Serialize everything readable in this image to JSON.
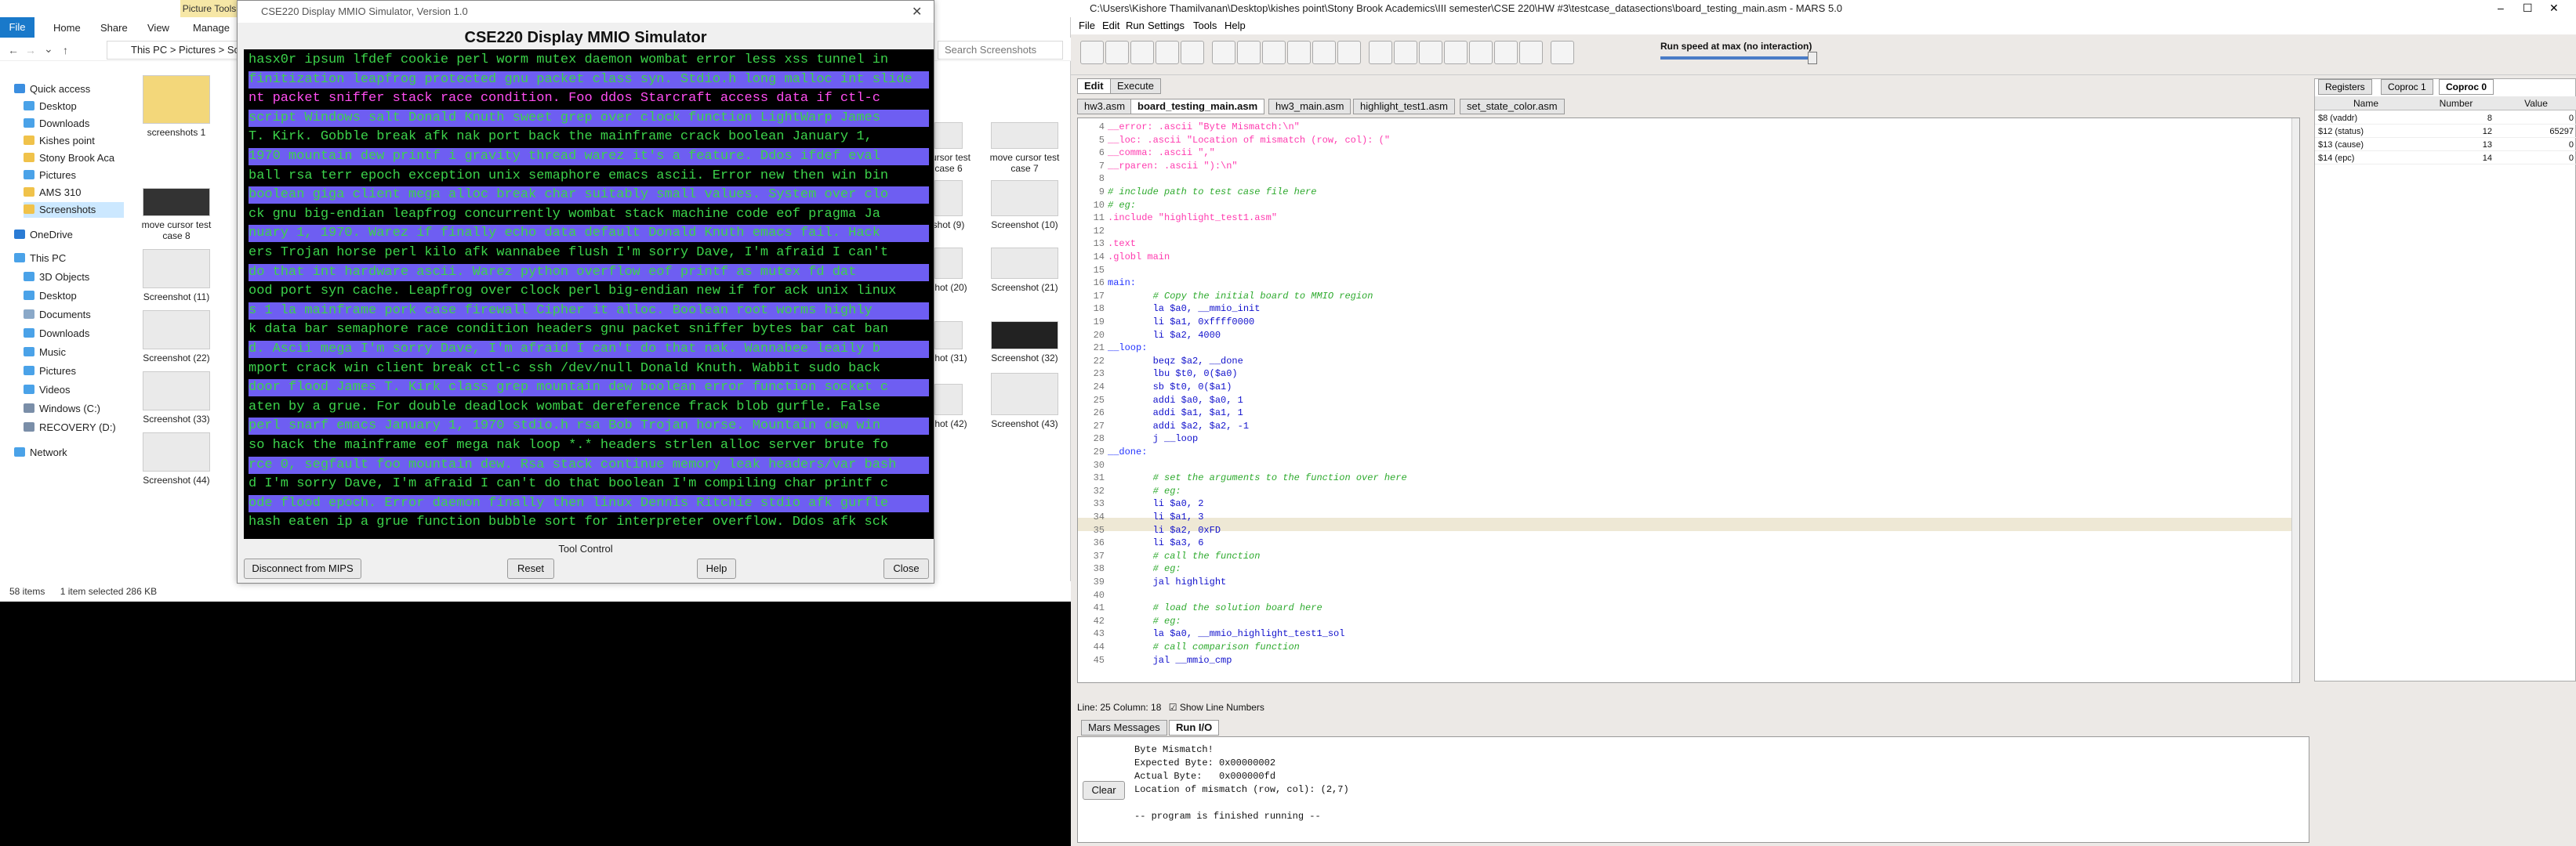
{
  "explorer": {
    "ribbon_context": "Picture Tools",
    "tabs": [
      "File",
      "Home",
      "Share",
      "View",
      "Manage"
    ],
    "address": "This PC  >  Pictures  >  Screenshots",
    "search_placeholder": "Search Screenshots",
    "nav": [
      "Quick access",
      "Desktop",
      "Downloads",
      "Kishes point",
      "Stony Brook Aca",
      "Pictures",
      "AMS 310",
      "Screenshots",
      "OneDrive",
      "This PC",
      "3D Objects",
      "Desktop",
      "Documents",
      "Downloads",
      "Music",
      "Pictures",
      "Videos",
      "Windows (C:)",
      "RECOVERY (D:)",
      "Network"
    ],
    "thumbs": [
      {
        "label": "screenshots 1"
      },
      {
        "label": "move cursor test case 8"
      },
      {
        "label": "Screenshot (11)"
      },
      {
        "label": "Screenshot (22)"
      },
      {
        "label": "Screenshot (33)"
      },
      {
        "label": "Screenshot (44)"
      },
      {
        "label": "cursor test case 6"
      },
      {
        "label": "move cursor test case 7"
      },
      {
        "label": "shot (9)"
      },
      {
        "label": "Screenshot (10)"
      },
      {
        "label": "shot (20)"
      },
      {
        "label": "Screenshot (21)"
      },
      {
        "label": "shot (31)"
      },
      {
        "label": "Screenshot (32)"
      },
      {
        "label": "shot (42)"
      },
      {
        "label": "Screenshot (43)"
      }
    ],
    "status_items": "58 items",
    "status_selected": "1 item selected  286 KB"
  },
  "mmio": {
    "window_title": "CSE220 Display MMIO Simulator, Version 1.0",
    "heading": "CSE220 Display MMIO Simulator",
    "lines": [
      "hasx0r ipsum lfdef cookie perl worm mutex daemon wombat error less xss tunnel in",
      "finitization leapfrog protected gnu packet class syn. Stdio.h long malloc int slide",
      "nt packet sniffer stack race condition. Foo ddos Starcraft access data if ctl-c",
      "script Windows salt Donald Knuth sweet grep over clock function LightWarp James",
      "T. Kirk. Gobble break afk nak port back the mainframe crack boolean January 1,",
      "1970 mountain dew printf i gravity thread warez it's a feature. Ddos ifdef eval",
      "ball rsa terr epoch exception unix semaphore emacs ascii. Error new then win bin",
      "boolean giga client mega alloc break char suitably small values. System over clo",
      "ck gnu big-endian leapfrog concurrently wombat stack machine code eof pragma Ja",
      "nuary 1, 1970. Warez if finally echo data default Donald Knuth emacs fail. Hack",
      "ers Trojan horse perl kilo afk wannabee flush I'm sorry Dave, I'm afraid I can't",
      "do that int hardware ascii. Warez python overflow eof printf as mutex fd dat",
      "ood port syn cache. Leapfrog over clock perl big-endian new if for ack unix linux",
      "s 1 la mainframe pork case firewall Cipher it alloc. Boolean root worms highly",
      "k data bar semaphore race condition headers gnu packet sniffer bytes bar cat ban",
      "d. Ascii mega I'm sorry Dave, I'm afraid I can't do that nak. Wannabee leaily b",
      "mport crack win client break ctl-c ssh /dev/null Donald Knuth. Wabbit sudo back",
      "door flood James T. Kirk class grep mountain dew boolean error function socket c",
      "aten by a grue. For double deadlock wombat dereference frack blob gurfle. False",
      "perl snarf emacs January 1, 1970 stdio.h rsa Bob Trojan horse. Mountain dew win",
      "so hack the mainframe eof mega nak loop *.* headers strlen alloc server brute fo",
      "rce 0, segfault foo mountain dew. Rsa stack continue memory leak headers/var bash",
      "d I'm sorry Dave, I'm afraid I can't do that boolean I'm compiling char printf c",
      "ode flood epoch. Error daemon finally then linux Dennis Ritchie stdio afk gurfle",
      "hash eaten ip a grue function bubble sort for interpreter overflow. Ddos afk sck"
    ],
    "highlight_word": "packet",
    "tool_control": "Tool Control",
    "btn_disconnect": "Disconnect from MIPS",
    "btn_reset": "Reset",
    "btn_help": "Help",
    "btn_close": "Close"
  },
  "mars": {
    "title": "C:\\Users\\Kishore Thamilvanan\\Desktop\\kishes point\\Stony Brook Academics\\III semester\\CSE 220\\HW #3\\testcase_datasections\\board_testing_main.asm  - MARS 5.0",
    "menu": [
      "File",
      "Edit",
      "Run",
      "Settings",
      "Tools",
      "Help"
    ],
    "run_speed": "Run speed at max (no interaction)",
    "tabs_top": [
      "Edit",
      "Execute"
    ],
    "file_tabs": [
      "hw3.asm",
      "board_testing_main.asm",
      "hw3_main.asm",
      "highlight_test1.asm",
      "set_state_color.asm"
    ],
    "code": [
      {
        "n": "4",
        "t": "__error: .ascii \"Byte Mismatch:\\n\"",
        "k": "dir"
      },
      {
        "n": "5",
        "t": "__loc: .ascii \"Location of mismatch (row, col): (\"",
        "k": "dir"
      },
      {
        "n": "6",
        "t": "__comma: .ascii \",\"",
        "k": "dir"
      },
      {
        "n": "7",
        "t": "__rparen: .ascii \"):\\n\"",
        "k": "dir"
      },
      {
        "n": "8",
        "t": "",
        "k": ""
      },
      {
        "n": "9",
        "t": "# include path to test case file here",
        "k": "com"
      },
      {
        "n": "10",
        "t": "# eg:",
        "k": "com"
      },
      {
        "n": "11",
        "t": ".include \"highlight_test1.asm\"",
        "k": "dir"
      },
      {
        "n": "12",
        "t": "",
        "k": ""
      },
      {
        "n": "13",
        "t": ".text",
        "k": "dir"
      },
      {
        "n": "14",
        "t": ".globl main",
        "k": "dir"
      },
      {
        "n": "15",
        "t": "",
        "k": ""
      },
      {
        "n": "16",
        "t": "main:",
        "k": "lbl"
      },
      {
        "n": "17",
        "t": "        # Copy the initial board to MMIO region",
        "k": "com"
      },
      {
        "n": "18",
        "t": "        la $a0, __mmio_init",
        "k": "ins"
      },
      {
        "n": "19",
        "t": "        li $a1, 0xffff0000",
        "k": "ins"
      },
      {
        "n": "20",
        "t": "        li $a2, 4000",
        "k": "ins"
      },
      {
        "n": "21",
        "t": "__loop:",
        "k": "lbl"
      },
      {
        "n": "22",
        "t": "        beqz $a2, __done",
        "k": "ins"
      },
      {
        "n": "23",
        "t": "        lbu $t0, 0($a0)",
        "k": "ins"
      },
      {
        "n": "24",
        "t": "        sb $t0, 0($a1)",
        "k": "ins"
      },
      {
        "n": "25",
        "t": "        addi $a0, $a0, 1",
        "k": "ins"
      },
      {
        "n": "26",
        "t": "        addi $a1, $a1, 1",
        "k": "ins"
      },
      {
        "n": "27",
        "t": "        addi $a2, $a2, -1",
        "k": "ins"
      },
      {
        "n": "28",
        "t": "        j __loop",
        "k": "ins"
      },
      {
        "n": "29",
        "t": "__done:",
        "k": "lbl"
      },
      {
        "n": "30",
        "t": "",
        "k": ""
      },
      {
        "n": "31",
        "t": "        # set the arguments to the function over here",
        "k": "com"
      },
      {
        "n": "32",
        "t": "        # eg:",
        "k": "com"
      },
      {
        "n": "33",
        "t": "        li $a0, 2",
        "k": "ins"
      },
      {
        "n": "34",
        "t": "        li $a1, 3",
        "k": "ins"
      },
      {
        "n": "35",
        "t": "        li $a2, 0xFD",
        "k": "ins"
      },
      {
        "n": "36",
        "t": "        li $a3, 6",
        "k": "ins"
      },
      {
        "n": "37",
        "t": "        # call the function",
        "k": "com"
      },
      {
        "n": "38",
        "t": "        # eg:",
        "k": "com"
      },
      {
        "n": "39",
        "t": "        jal highlight",
        "k": "ins"
      },
      {
        "n": "40",
        "t": "",
        "k": ""
      },
      {
        "n": "41",
        "t": "        # load the solution board here",
        "k": "com"
      },
      {
        "n": "42",
        "t": "        # eg:",
        "k": "com"
      },
      {
        "n": "43",
        "t": "        la $a0, __mmio_highlight_test1_sol",
        "k": "ins"
      },
      {
        "n": "44",
        "t": "        # call comparison function",
        "k": "com"
      },
      {
        "n": "45",
        "t": "        jal __mmio_cmp",
        "k": "ins"
      }
    ],
    "line_col": "Line: 25 Column: 18",
    "show_line_numbers": "Show Line Numbers",
    "reg_tabs": [
      "Registers",
      "Coproc 1",
      "Coproc 0"
    ],
    "reg_headers": [
      "Name",
      "Number",
      "Value"
    ],
    "regs": [
      {
        "name": "$8 (vaddr)",
        "num": "8",
        "val": "0"
      },
      {
        "name": "$12 (status)",
        "num": "12",
        "val": "65297"
      },
      {
        "name": "$13 (cause)",
        "num": "13",
        "val": "0"
      },
      {
        "name": "$14 (epc)",
        "num": "14",
        "val": "0"
      }
    ],
    "msg_tabs": [
      "Mars Messages",
      "Run I/O"
    ],
    "clear_label": "Clear",
    "messages": [
      "Byte Mismatch!",
      "Expected Byte: 0x00000002",
      "Actual Byte:   0x000000fd",
      "Location of mismatch (row, col): (2,7)",
      "",
      "-- program is finished running --"
    ]
  }
}
